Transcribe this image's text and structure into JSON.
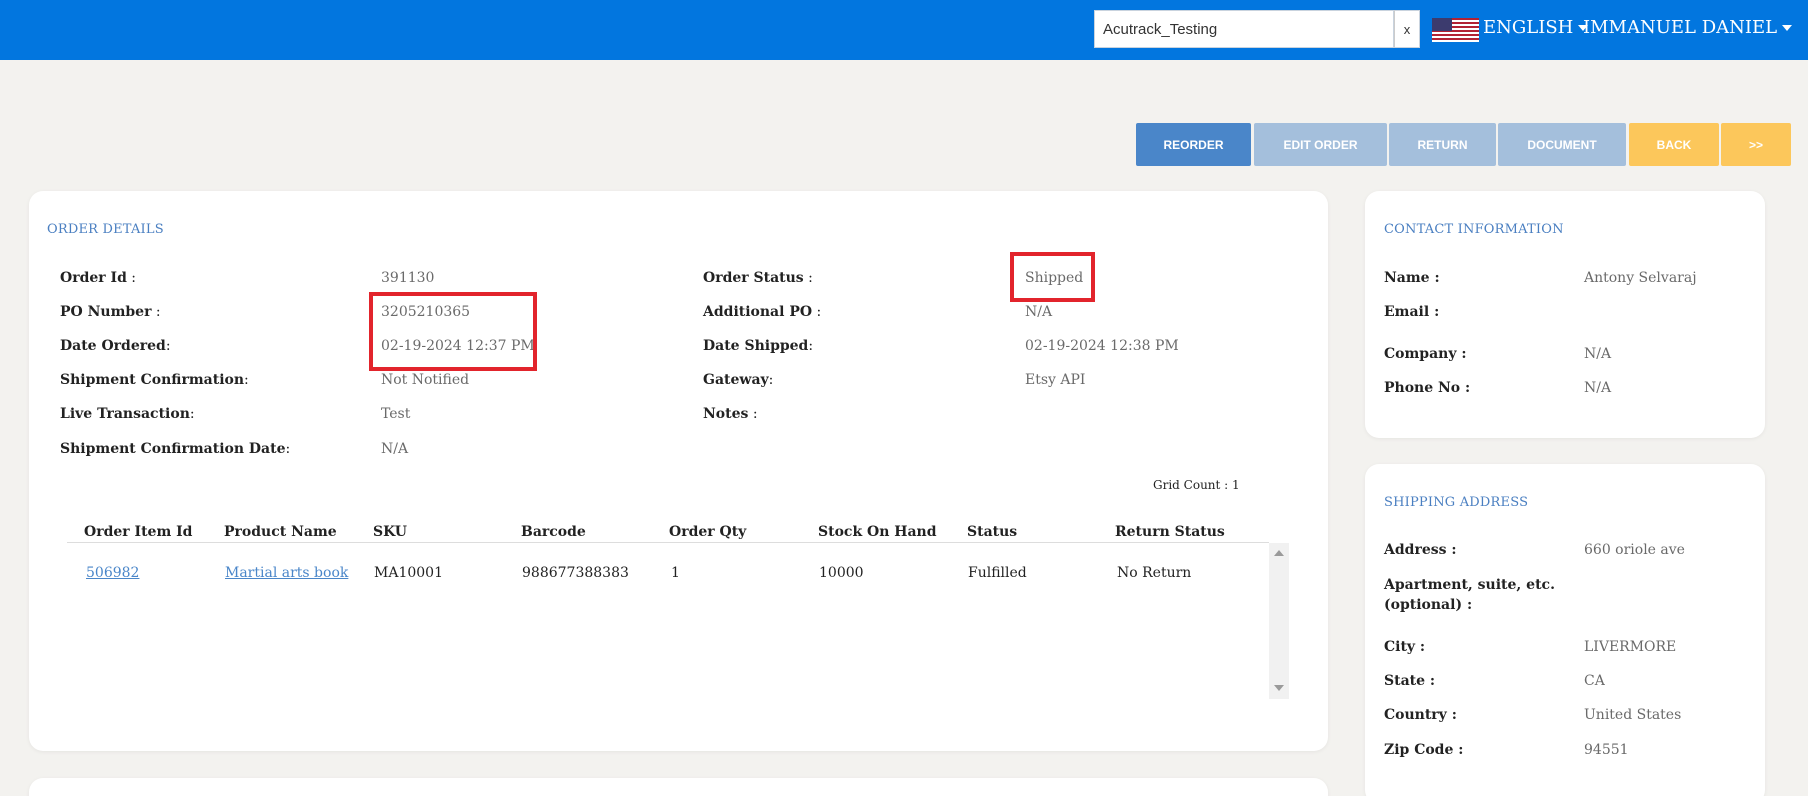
{
  "header": {
    "search_value": "Acutrack_Testing",
    "clear_label": "x",
    "language": "ENGLISH",
    "user": "IMMANUEL DANIEL"
  },
  "actions": {
    "reorder": "REORDER",
    "edit_order": "EDIT ORDER",
    "return": "RETURN",
    "document": "DOCUMENT",
    "back": "BACK",
    "next": ">>"
  },
  "order_details": {
    "title": "ORDER DETAILS",
    "order_id_label": "Order Id",
    "order_id": "391130",
    "po_number_label": "PO Number",
    "po_number": "3205210365",
    "date_ordered_label": "Date Ordered",
    "date_ordered": "02-19-2024 12:37 PM",
    "shipment_confirmation_label": "Shipment Confirmation",
    "shipment_confirmation": "Not Notified",
    "live_transaction_label": "Live Transaction",
    "live_transaction": "Test",
    "shipment_confirmation_date_label": "Shipment Confirmation Date",
    "shipment_confirmation_date": "N/A",
    "order_status_label": "Order Status",
    "order_status": "Shipped",
    "additional_po_label": "Additional PO",
    "additional_po": "N/A",
    "date_shipped_label": "Date Shipped",
    "date_shipped": "02-19-2024 12:38 PM",
    "gateway_label": "Gateway",
    "gateway": "Etsy API",
    "notes_label": "Notes",
    "grid_count": "Grid Count : 1"
  },
  "items_table": {
    "columns": [
      "Order Item Id",
      "Product Name",
      "SKU",
      "Barcode",
      "Order Qty",
      "Stock On Hand",
      "Status",
      "Return Status"
    ],
    "rows": [
      [
        "506982",
        "Martial arts book",
        "MA10001",
        "988677388383",
        "1",
        "10000",
        "Fulfilled",
        "No Return"
      ]
    ]
  },
  "contact": {
    "title": "CONTACT INFORMATION",
    "name_label": "Name :",
    "name": "Antony Selvaraj",
    "email_label": "Email :",
    "company_label": "Company :",
    "company": "N/A",
    "phone_label": "Phone No :",
    "phone": "N/A"
  },
  "shipping": {
    "title": "SHIPPING ADDRESS",
    "address_label": "Address :",
    "address": "660 oriole ave",
    "apt_label_1": "Apartment, suite, etc.",
    "apt_label_2": "(optional) :",
    "city_label": "City :",
    "city": "LIVERMORE",
    "state_label": "State :",
    "state": "CA",
    "country_label": "Country :",
    "country": "United States",
    "zip_label": "Zip Code :",
    "zip": "94551"
  },
  "colors": {
    "header_blue": "#0276df",
    "primary_button": "#4a86c9",
    "disabled_button": "#a4bfdc",
    "warning_button": "#fcc75b",
    "highlight_red": "#e2242c",
    "section_title": "#4a7fc1"
  }
}
